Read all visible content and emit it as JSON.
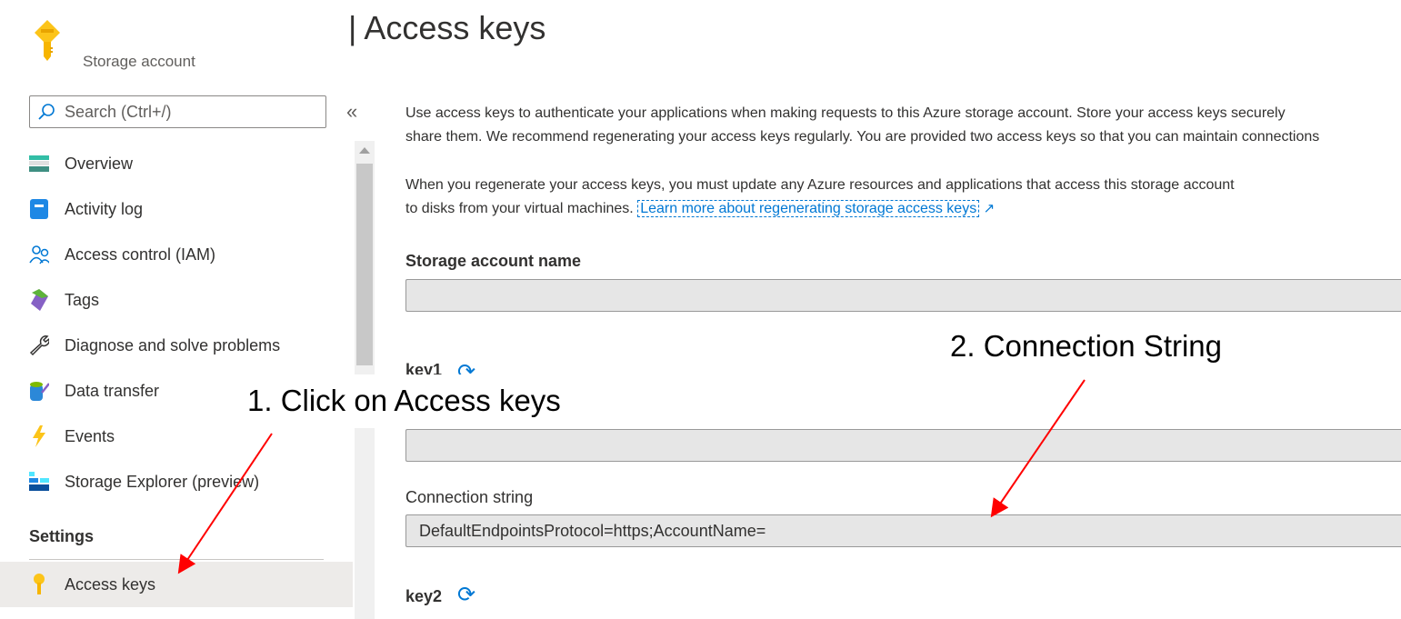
{
  "header": {
    "resource_type": "Storage account",
    "title": "| Access keys"
  },
  "sidebar": {
    "search_placeholder": "Search (Ctrl+/)",
    "collapse_label": "«",
    "items": [
      {
        "label": "Overview",
        "icon": "overview-icon"
      },
      {
        "label": "Activity log",
        "icon": "activity-log-icon"
      },
      {
        "label": "Access control (IAM)",
        "icon": "people-icon"
      },
      {
        "label": "Tags",
        "icon": "tag-icon"
      },
      {
        "label": "Diagnose and solve problems",
        "icon": "wrench-icon"
      },
      {
        "label": "Data transfer",
        "icon": "data-transfer-icon"
      },
      {
        "label": "Events",
        "icon": "lightning-icon"
      },
      {
        "label": "Storage Explorer (preview)",
        "icon": "storage-explorer-icon"
      }
    ],
    "section_settings": "Settings",
    "active_item": {
      "label": "Access keys",
      "icon": "key-icon"
    }
  },
  "main": {
    "intro_line1": "Use access keys to authenticate your applications when making requests to this Azure storage account. Store your access keys securely",
    "intro_line2": "share them. We recommend regenerating your access keys regularly. You are provided two access keys so that you can maintain connections",
    "regen_line1": "When you regenerate your access keys, you must update any Azure resources and applications that access this storage account",
    "regen_line2_prefix": "to disks from your virtual machines.",
    "learn_more_link": "Learn more about regenerating storage access keys",
    "storage_account_name_label": "Storage account name",
    "storage_account_name_value": "",
    "key1_label": "key1",
    "key1_value": "",
    "connection_string_label": "Connection string",
    "connection_string_value": "DefaultEndpointsProtocol=https;AccountName=",
    "key2_label": "key2"
  },
  "annotations": {
    "step1": "1. Click on Access keys",
    "step2": "2. Connection String",
    "arrow_color": "#ff0000"
  },
  "colors": {
    "accent": "#0078d4",
    "key": "#fcd116",
    "active_bg": "#edebe9"
  }
}
